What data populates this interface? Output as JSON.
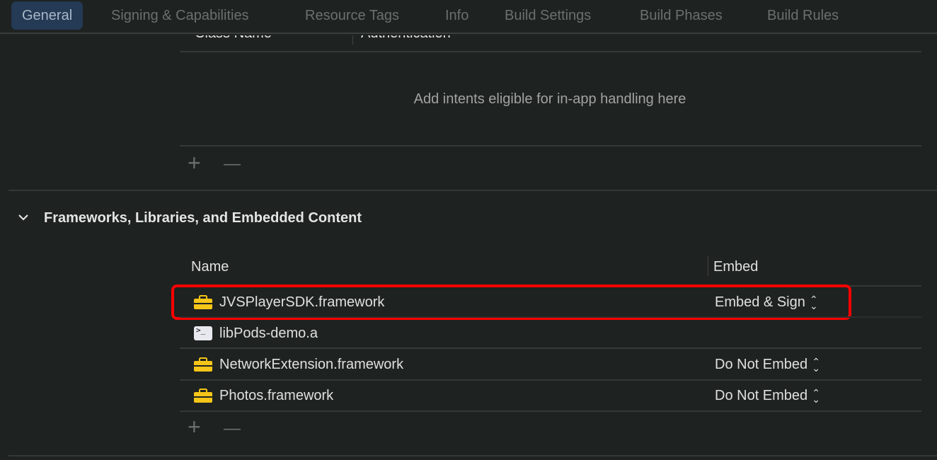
{
  "tabs": [
    "General",
    "Signing & Capabilities",
    "Resource Tags",
    "Info",
    "Build Settings",
    "Build Phases",
    "Build Rules"
  ],
  "intents": {
    "col_class": "Class Name",
    "col_auth": "Authentication",
    "placeholder": "Add intents eligible for in-app handling here"
  },
  "section": {
    "title": "Frameworks, Libraries, and Embedded Content",
    "col_name": "Name",
    "col_embed": "Embed"
  },
  "rows": [
    {
      "name": "JVSPlayerSDK.framework",
      "icon": "toolbox-icon",
      "embed": "Embed & Sign",
      "highlighted": true
    },
    {
      "name": "libPods-demo.a",
      "icon": "terminal-icon",
      "embed": ""
    },
    {
      "name": "NetworkExtension.framework",
      "icon": "toolbox-icon",
      "embed": "Do Not Embed"
    },
    {
      "name": "Photos.framework",
      "icon": "toolbox-icon",
      "embed": "Do Not Embed"
    }
  ],
  "controls": {
    "add": "+",
    "remove": "—"
  },
  "colors": {
    "highlight": "#ff0000",
    "tab_active": "#243a55",
    "icon": "#f5c518"
  }
}
